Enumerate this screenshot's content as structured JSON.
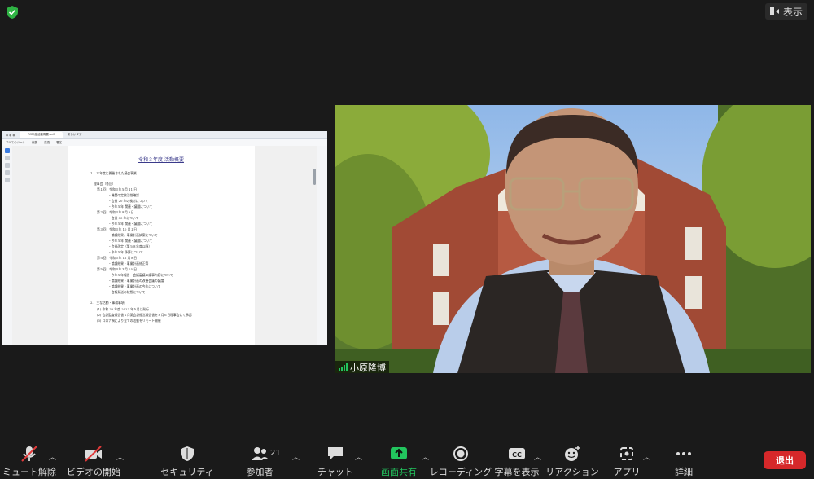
{
  "topbar": {
    "view_label": "表示"
  },
  "share": {
    "tab_label": "R3年度活動概要.pdf",
    "tab2": "新しいタブ",
    "toolbar_items": [
      "すべてのツール",
      "編集",
      "変換",
      "署名"
    ],
    "doc": {
      "title": "令和３年度 活動概要",
      "lines": [
        "1.　本年度に開催された議会事業",
        "理事会（各回）",
        "第１回　令和３年５月 11 日",
        "・機関の定数活性確認",
        "・会費 20 年の検討について",
        "・今年５年 関連・議題について",
        "第２回　令和３年８月５日",
        "・会費 30 年について",
        "・今年５年 関連・議題について",
        "第３回　令和３年 10 月１日",
        "・論議結果、事業計画試案について",
        "・今年５年 関連・議題について",
        "・会費改定（第５８年度以降）",
        "・今年５年 予算について",
        "第４回　令和３年 12 月８日",
        "・論議結果・事業計画修正等",
        "第５回　令和４年３月 25 日",
        "・今年５年報告・会議審議の議事内容について",
        "・論議結果・事業計画の改善会議の議論",
        "・論議結果・事業計画の今年について",
        "・会報発送の状態について",
        "2.　主な活動・事務事項",
        "(1) 令和 30 年度 2023 年５月に発行",
        "(2) 会計監査報告書１月第会計経営報告書を８月６日理事会にて承認",
        "(3) コロナ禍により全ての活動をリモート開催"
      ]
    }
  },
  "video": {
    "participant_name": "小原隆博"
  },
  "toolbar": {
    "mute_label": "ミュート解除",
    "video_label": "ビデオの開始",
    "security_label": "セキュリティ",
    "participants_label": "参加者",
    "participants_count": "21",
    "chat_label": "チャット",
    "share_label": "画面共有",
    "record_label": "レコーディング",
    "captions_label": "字幕を表示",
    "reactions_label": "リアクション",
    "apps_label": "アプリ",
    "more_label": "詳細",
    "leave_label": "退出"
  },
  "colors": {
    "background": "#1a1a1a",
    "share_green": "#22c55e",
    "leave_red": "#d6282a",
    "shield_green": "#2fb344"
  }
}
